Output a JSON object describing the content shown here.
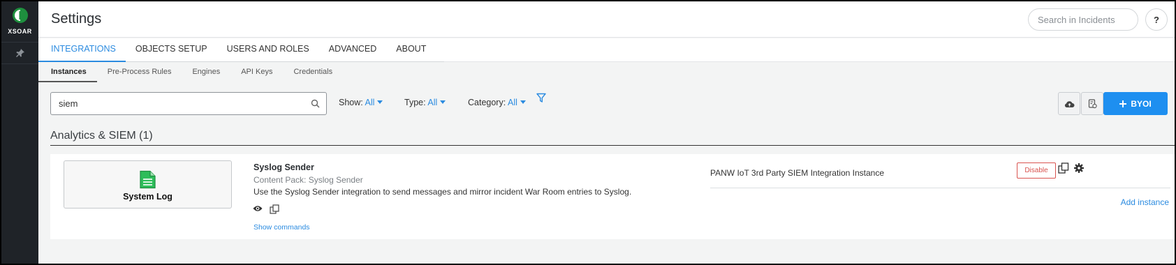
{
  "brand": {
    "name": "XSOAR",
    "logo_icon": "xsoar-logo-icon",
    "color": "#1e8f3e"
  },
  "nav": {
    "pin_icon": "pin-icon"
  },
  "header": {
    "title": "Settings",
    "search_placeholder": "Search in Incidents",
    "help_label": "?"
  },
  "tabs": [
    {
      "label": "INTEGRATIONS",
      "active": true
    },
    {
      "label": "OBJECTS SETUP",
      "active": false
    },
    {
      "label": "USERS AND ROLES",
      "active": false
    },
    {
      "label": "ADVANCED",
      "active": false
    },
    {
      "label": "ABOUT",
      "active": false
    }
  ],
  "subtabs": [
    {
      "label": "Instances",
      "active": true
    },
    {
      "label": "Pre-Process Rules",
      "active": false
    },
    {
      "label": "Engines",
      "active": false
    },
    {
      "label": "API Keys",
      "active": false
    },
    {
      "label": "Credentials",
      "active": false
    }
  ],
  "filters": {
    "search_value": "siem",
    "show_label": "Show:",
    "show_value": "All",
    "type_label": "Type:",
    "type_value": "All",
    "category_label": "Category:",
    "category_value": "All"
  },
  "actions": {
    "upload_icon": "cloud-upload-icon",
    "settings_icon": "document-settings-icon",
    "byoi_label": "BYOI"
  },
  "section": {
    "title": "Analytics & SIEM (1)"
  },
  "integration": {
    "logo_label": "System Log",
    "name": "Syslog Sender",
    "content_pack_label": "Content Pack:",
    "content_pack_value": "Syslog Sender",
    "description": "Use the Syslog Sender integration to send messages and mirror incident War Room entries to Syslog.",
    "show_commands": "Show commands",
    "instance_name": "PANW IoT 3rd Party SIEM Integration Instance",
    "disable_label": "Disable",
    "add_instance": "Add instance"
  },
  "colors": {
    "accent": "#2b8be0",
    "primary_button": "#1e8ff0",
    "danger": "#d9534f",
    "sidebar": "#1f2328"
  }
}
